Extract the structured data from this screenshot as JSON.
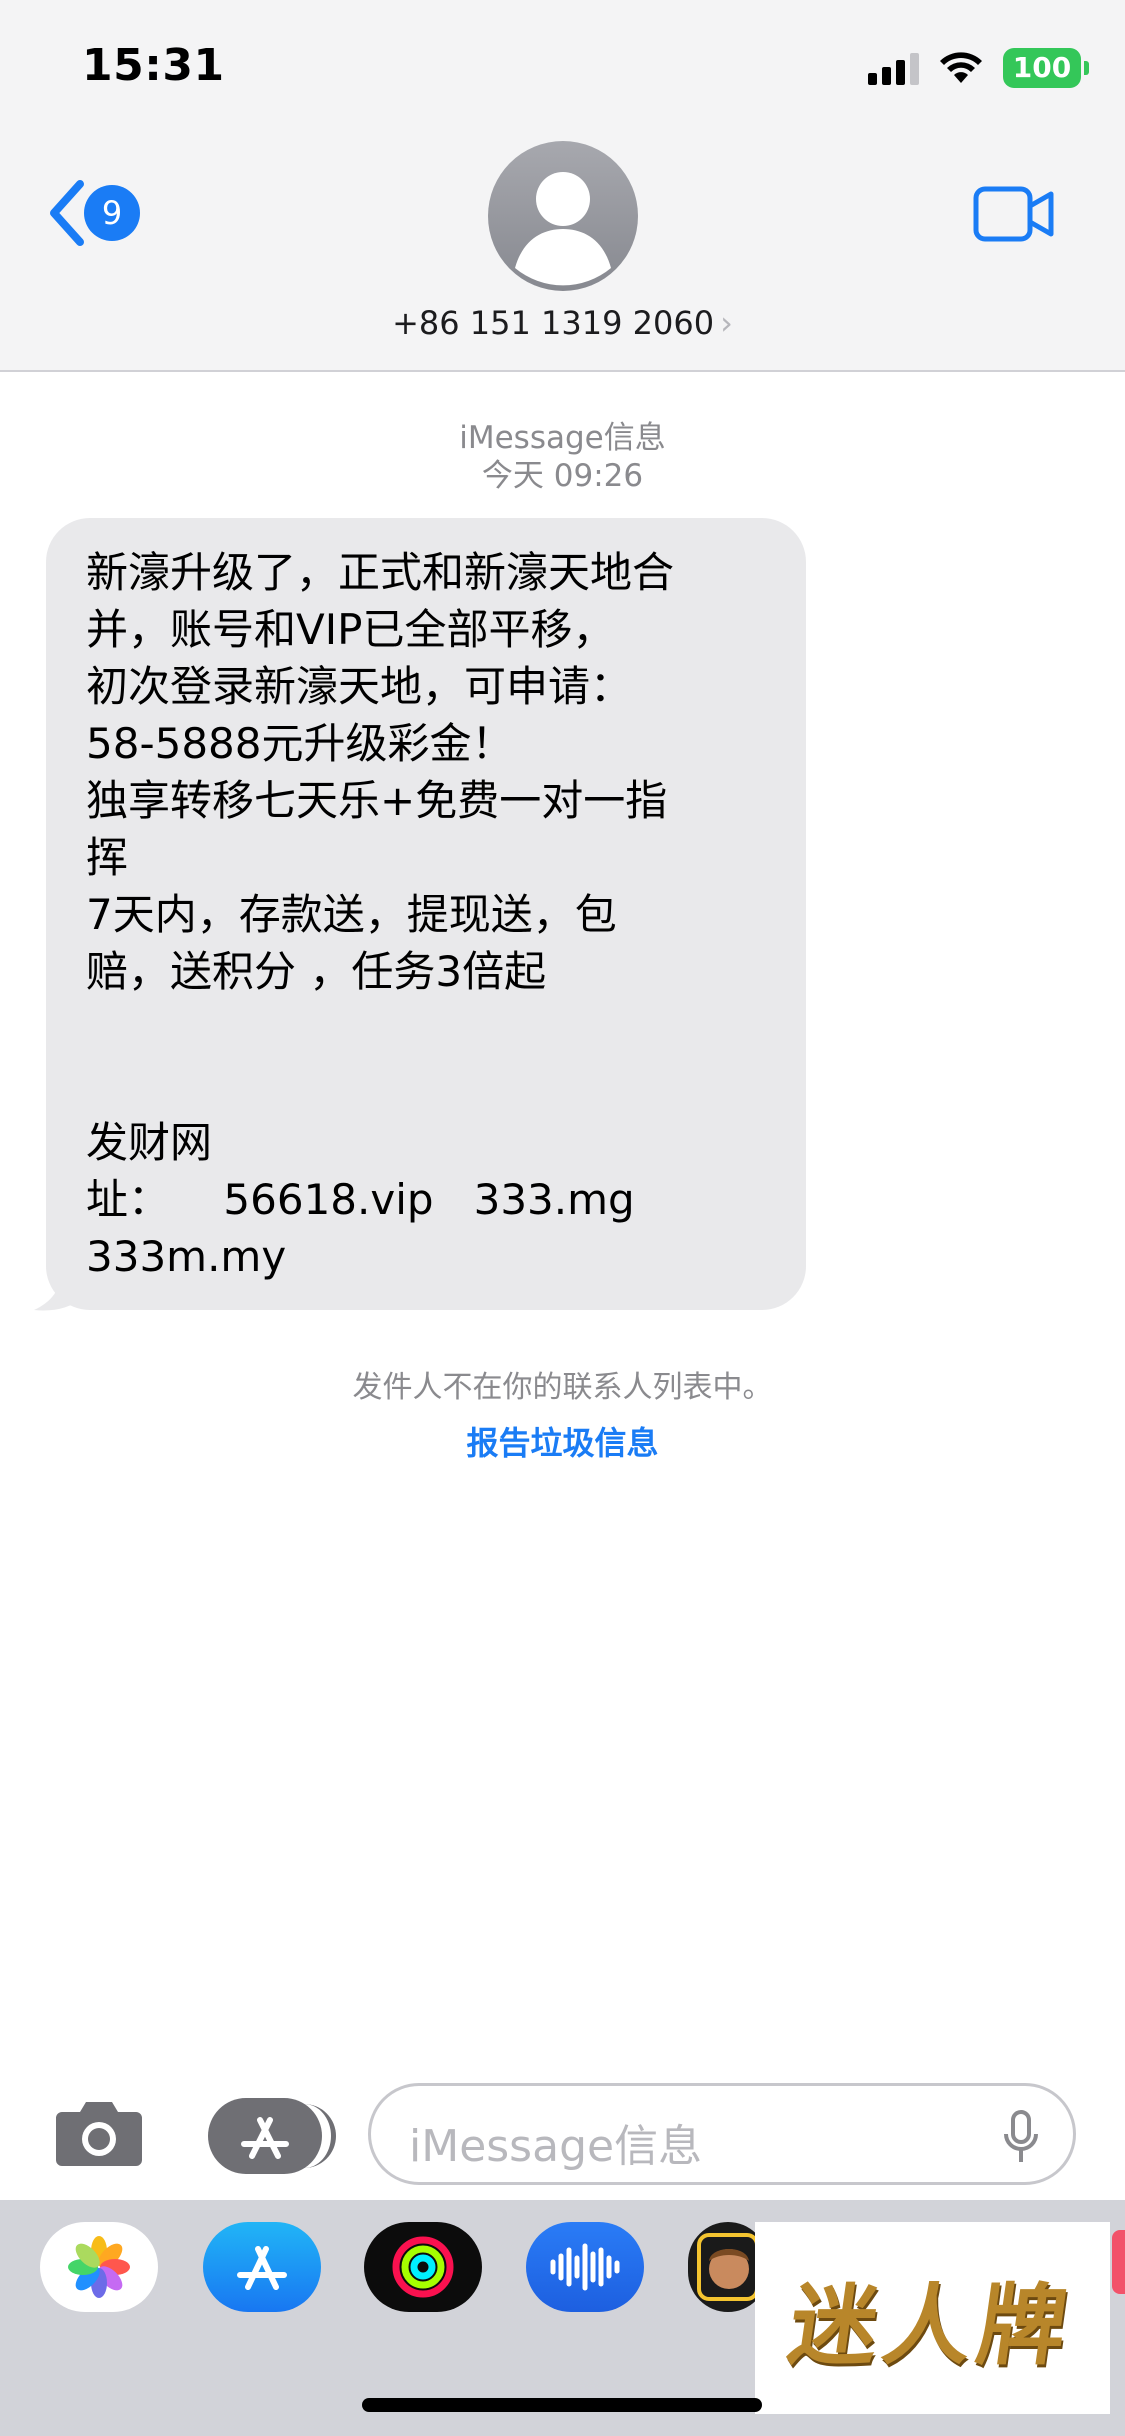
{
  "status_bar": {
    "time": "15:31",
    "battery": "100"
  },
  "header": {
    "back_badge": "9",
    "contact": "+86 151 1319 2060",
    "chevron": "›"
  },
  "conversation": {
    "service": "iMessage信息",
    "timestamp": "今天 09:26",
    "message_lines": [
      "新濠升级了，正式和新濠天地合",
      "并，账号和VIP已全部平移，",
      "初次登录新濠天地，可申请：",
      "58-5888元升级彩金！",
      "独享转移七天乐+免费一对一指",
      "挥",
      "7天内，存款送，提现送，包",
      "赔，送积分 ，任务3倍起",
      "",
      "",
      "发财网",
      "址：    56618.vip   333.mg",
      "333m.my"
    ],
    "unknown_sender_notice": "发件人不在你的联系人列表中。",
    "report_junk_label": "报告垃圾信息"
  },
  "input_bar": {
    "placeholder": "iMessage信息"
  },
  "app_tray": {
    "apps": [
      "photos-icon",
      "app-store-icon",
      "activity-icon",
      "voice-memo-icon",
      "memoji-icon"
    ]
  },
  "watermark": {
    "text": "迷人牌"
  },
  "colors": {
    "accent": "#1a7cf5",
    "bubble": "#e9e9eb",
    "header_bg": "#f4f4f5",
    "battery": "#34c759"
  }
}
